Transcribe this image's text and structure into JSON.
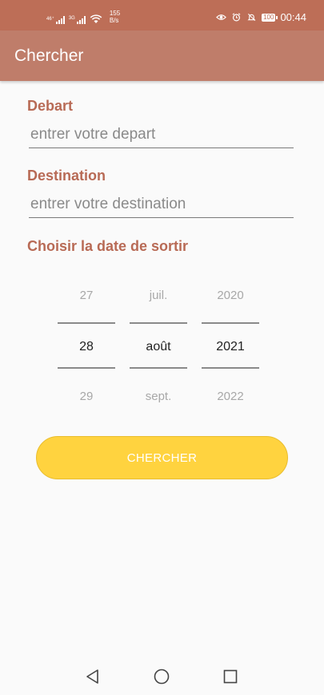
{
  "status_bar": {
    "net1": "46⁺",
    "net2": "3G",
    "speed_value": "155",
    "speed_unit": "B/s",
    "battery": "100",
    "time": "00:44"
  },
  "app_bar": {
    "title": "Chercher"
  },
  "form": {
    "depart_label": "Debart",
    "depart_placeholder": "entrer votre depart",
    "destination_label": "Destination",
    "destination_placeholder": "entrer votre destination",
    "date_label": "Choisir la date de sortir"
  },
  "date_picker": {
    "day": {
      "prev": "27",
      "selected": "28",
      "next": "29"
    },
    "month": {
      "prev": "juil.",
      "selected": "août",
      "next": "sept."
    },
    "year": {
      "prev": "2020",
      "selected": "2021",
      "next": "2022"
    }
  },
  "search_button": {
    "label": "CHERCHER"
  },
  "colors": {
    "status_bar": "#bd6e57",
    "app_bar": "#bf7d6a",
    "label_accent": "#b86a55",
    "button": "#ffd33f"
  },
  "icons": {
    "nav_back": "triangle-back-icon",
    "nav_home": "circle-home-icon",
    "nav_recents": "square-recents-icon"
  }
}
